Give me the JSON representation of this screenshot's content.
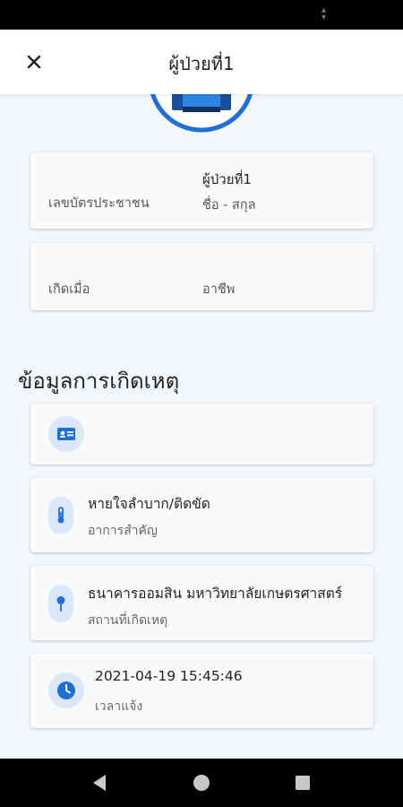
{
  "header": {
    "title": "ผู้ป่วยที่1",
    "close_icon": "close-icon"
  },
  "profile": {
    "name_value": "ผู้ป่วยที่1",
    "name_label": "ชื่อ - สกุล",
    "id_label": "เลขบัตรประชาชน",
    "birth_label": "เกิดเมื่อ",
    "occupation_label": "อาชีพ"
  },
  "incident": {
    "section_title": "ข้อมูลการเกิดเหตุ",
    "items": [
      {
        "icon": "id-card-icon",
        "value": "",
        "label": ""
      },
      {
        "icon": "thermometer-icon",
        "value": "หายใจลำบาก/ติดขัด",
        "label": "อาการสำคัญ"
      },
      {
        "icon": "location-pin-icon",
        "value": "ธนาคารออมสิน มหาวิทยาลัยเกษตรศาสตร์",
        "label": "สถานที่เกิดเหตุ"
      },
      {
        "icon": "clock-icon",
        "value": "2021-04-19 15:45:46",
        "label": "เวลาแจ้ง"
      }
    ]
  },
  "colors": {
    "accent": "#1e6fd9",
    "icon_bg": "#dce8fa",
    "card_bg": "#f8fafc",
    "page_bg": "#f4f7fa"
  }
}
